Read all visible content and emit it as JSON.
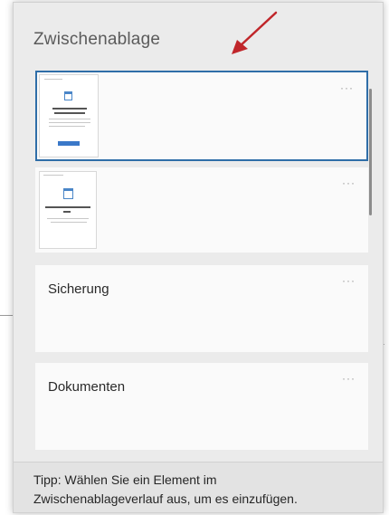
{
  "panel": {
    "title": "Zwischenablage",
    "items": [
      {
        "type": "image",
        "more": "···"
      },
      {
        "type": "image",
        "more": "···"
      },
      {
        "type": "text",
        "text": "Sicherung",
        "more": "···"
      },
      {
        "type": "text",
        "text": "Dokumenten",
        "more": "···"
      }
    ],
    "tip_line1": "Tipp: Wählen Sie ein Element im",
    "tip_line2": "Zwischenablageverlauf aus, um es einzufügen."
  },
  "colors": {
    "selection_border": "#2f6ea8",
    "annotation_arrow": "#c0262a"
  }
}
